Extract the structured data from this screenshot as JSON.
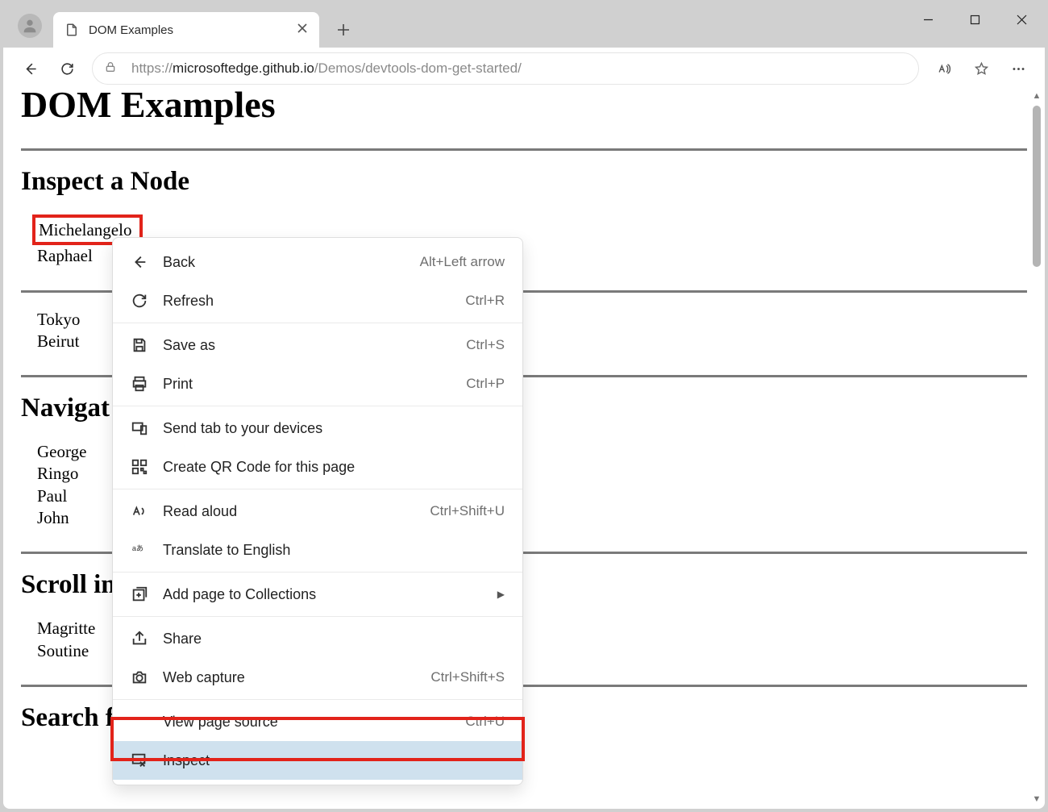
{
  "tab": {
    "title": "DOM Examples"
  },
  "address": {
    "prefix": "https://",
    "host": "microsoftedge.github.io",
    "path": "/Demos/devtools-dom-get-started/"
  },
  "page": {
    "h1": "DOM Examples",
    "section1": {
      "title": "Inspect a Node",
      "items": [
        "Michelangelo",
        "Raphael"
      ]
    },
    "section1b": {
      "items": [
        "Tokyo",
        "Beirut"
      ]
    },
    "section2": {
      "title": "Navigat",
      "items": [
        "George",
        "Ringo",
        "Paul",
        "John"
      ]
    },
    "section3": {
      "title": "Scroll in",
      "items": [
        "Magritte",
        "Soutine"
      ]
    },
    "section4": {
      "title": "Search f"
    }
  },
  "context_menu": {
    "back": {
      "label": "Back",
      "shortcut": "Alt+Left arrow"
    },
    "refresh": {
      "label": "Refresh",
      "shortcut": "Ctrl+R"
    },
    "saveas": {
      "label": "Save as",
      "shortcut": "Ctrl+S"
    },
    "print": {
      "label": "Print",
      "shortcut": "Ctrl+P"
    },
    "sendtab": {
      "label": "Send tab to your devices"
    },
    "qrcode": {
      "label": "Create QR Code for this page"
    },
    "readaloud": {
      "label": "Read aloud",
      "shortcut": "Ctrl+Shift+U"
    },
    "translate": {
      "label": "Translate to English"
    },
    "collections": {
      "label": "Add page to Collections"
    },
    "share": {
      "label": "Share"
    },
    "webcapture": {
      "label": "Web capture",
      "shortcut": "Ctrl+Shift+S"
    },
    "viewsource": {
      "label": "View page source",
      "shortcut": "Ctrl+U"
    },
    "inspect": {
      "label": "Inspect"
    }
  }
}
